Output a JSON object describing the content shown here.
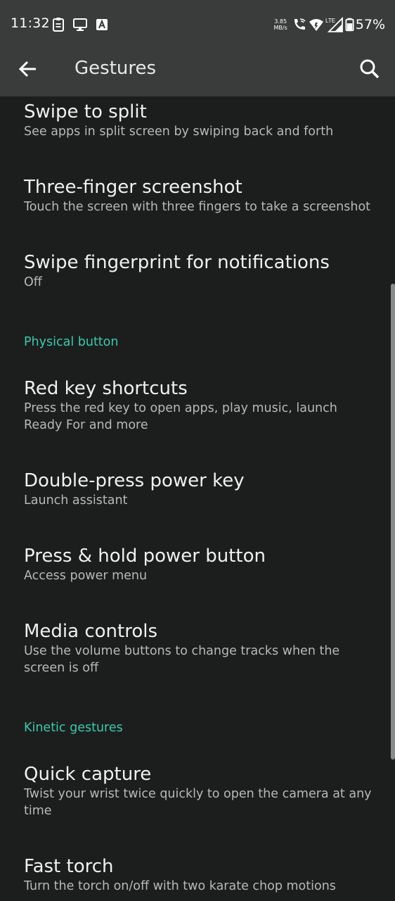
{
  "status_bar": {
    "time": "11:32",
    "speed_value": "3.85",
    "speed_unit": "MB/s",
    "network": "LTE",
    "battery": "57%"
  },
  "app_bar": {
    "title": "Gestures"
  },
  "items": [
    {
      "title": "Swipe to split",
      "subtitle": "See apps in split screen by swiping back and forth"
    },
    {
      "title": "Three-finger screenshot",
      "subtitle": "Touch the screen with three fingers to take a screenshot"
    },
    {
      "title": "Swipe fingerprint for notifications",
      "subtitle": "Off"
    },
    {
      "title": "Red key shortcuts",
      "subtitle": "Press the red key to open apps, play music, launch Ready For and more"
    },
    {
      "title": "Double-press power key",
      "subtitle": "Launch assistant"
    },
    {
      "title": "Press & hold power button",
      "subtitle": "Access power menu"
    },
    {
      "title": "Media controls",
      "subtitle": "Use the volume buttons to change tracks when the screen is off"
    },
    {
      "title": "Quick capture",
      "subtitle": "Twist your wrist twice quickly to open the camera at any time"
    },
    {
      "title": "Fast torch",
      "subtitle": "Turn the torch on/off with two karate chop motions"
    }
  ],
  "sections": {
    "physical_button": "Physical button",
    "kinetic_gestures": "Kinetic gestures"
  },
  "colors": {
    "accent": "#3cc8b0",
    "background": "#1c1e1e",
    "app_bar": "#3a3b3b"
  }
}
